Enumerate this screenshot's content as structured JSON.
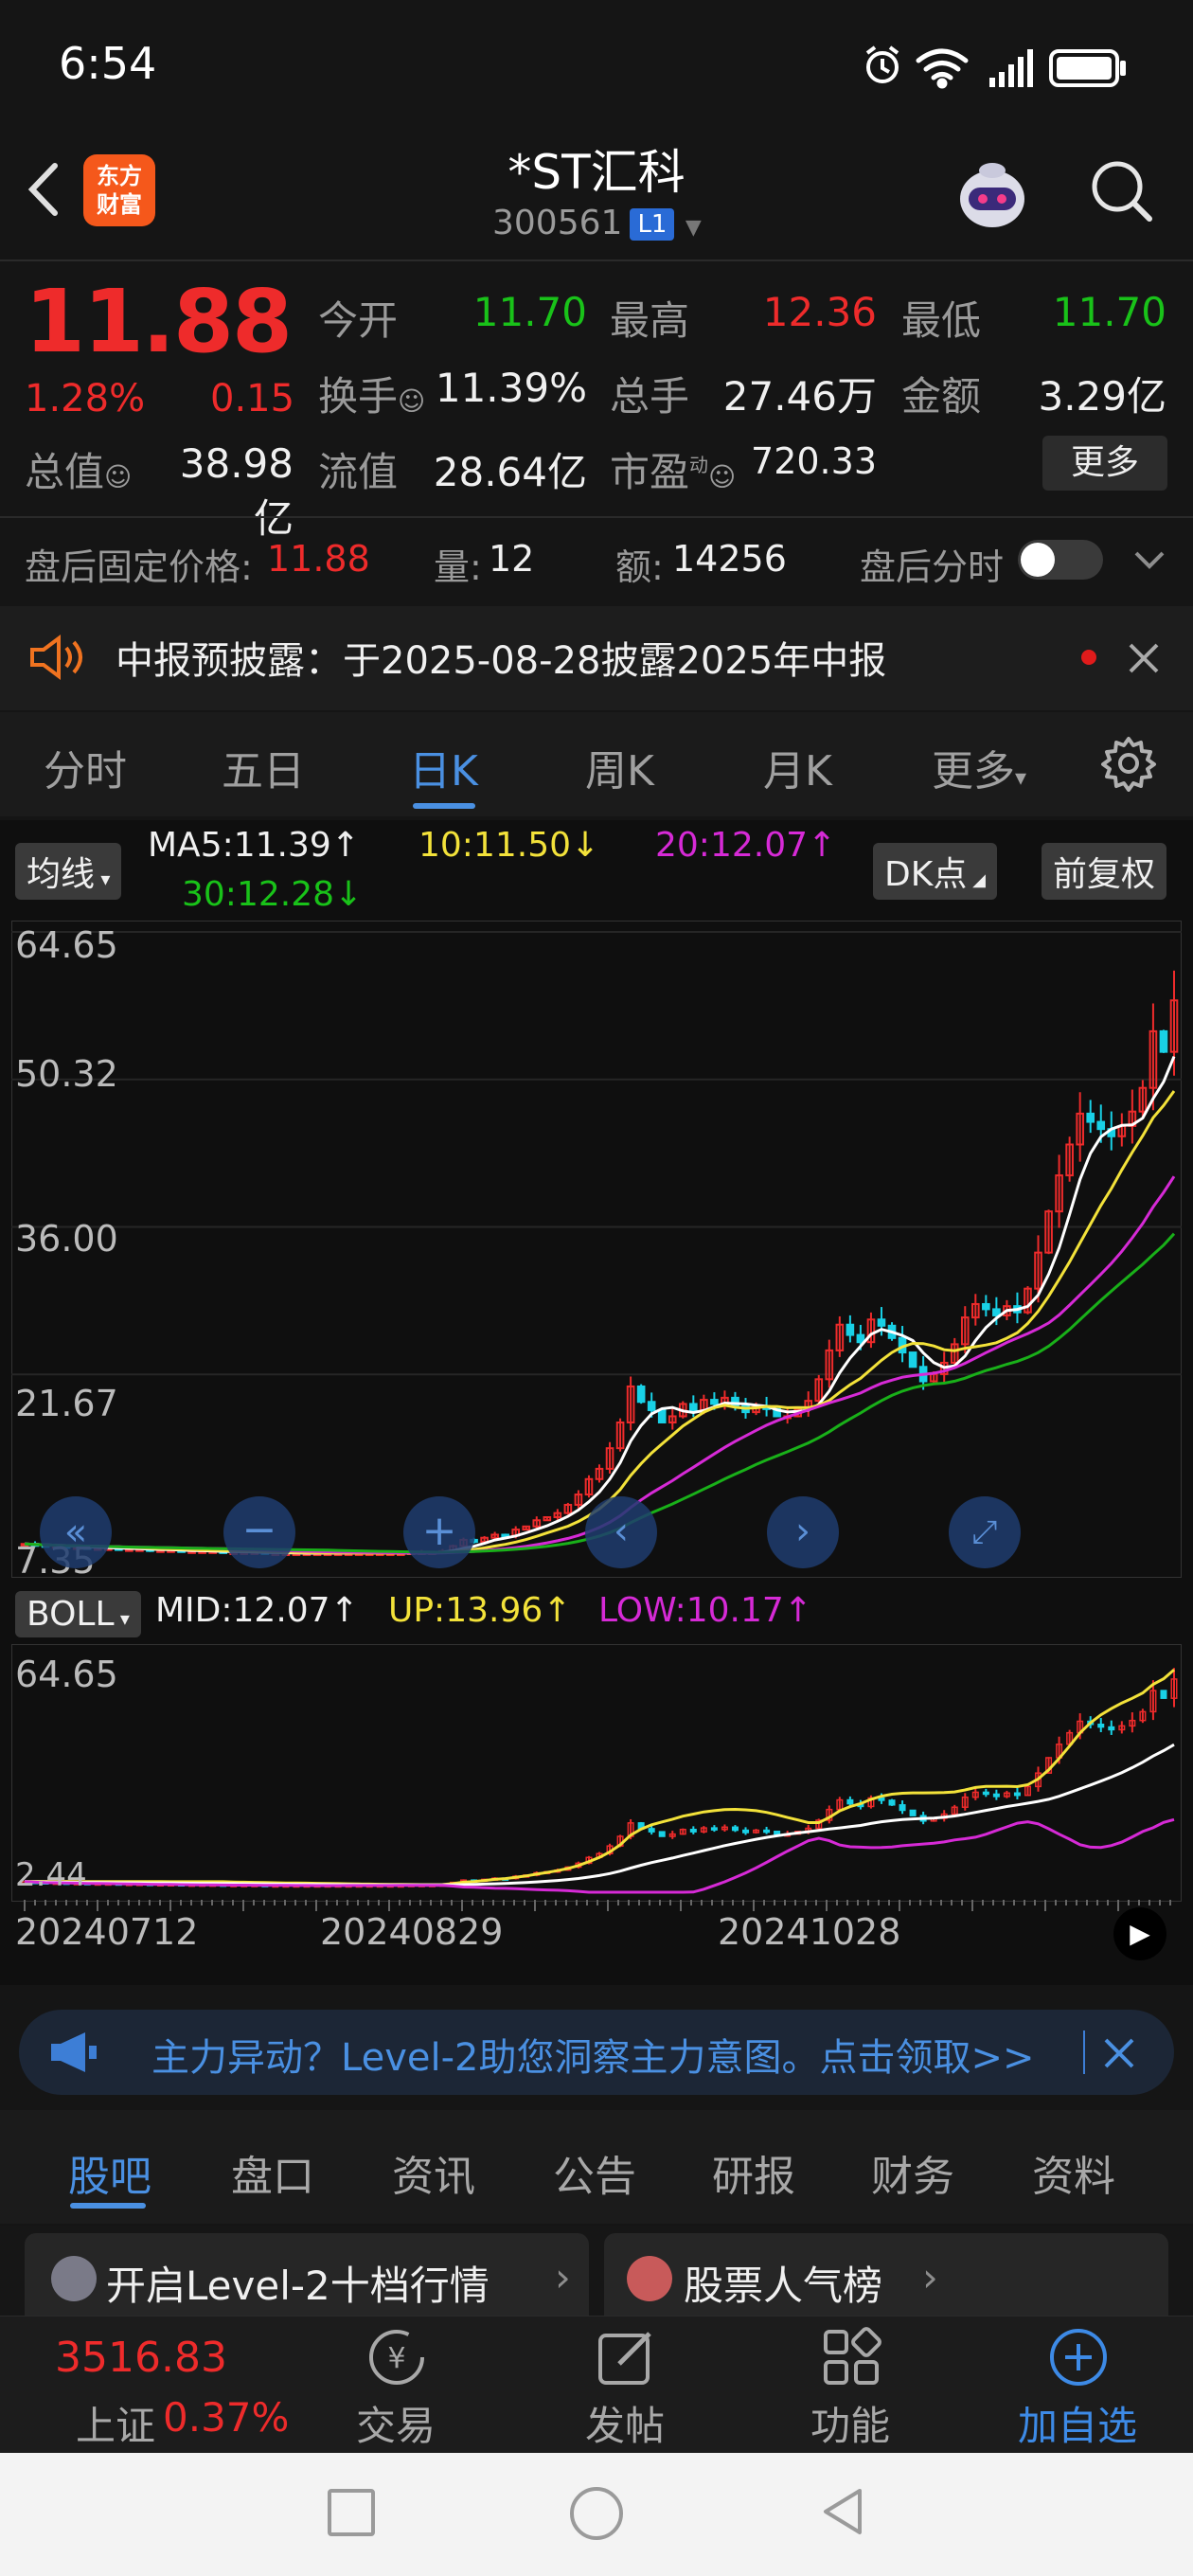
{
  "status": {
    "time": "6:54"
  },
  "header": {
    "logo_line1": "东方",
    "logo_line2": "财富",
    "name": "*ST汇科",
    "code": "300561",
    "level_badge": "L1"
  },
  "quote": {
    "price": "11.88",
    "change_pct": "1.28%",
    "change": "0.15",
    "fields": [
      {
        "label": "今开",
        "value": "11.70",
        "color": "green"
      },
      {
        "label": "最高",
        "value": "12.36",
        "color": "red"
      },
      {
        "label": "最低",
        "value": "11.70",
        "color": "green"
      },
      {
        "label": "换手",
        "value": "11.39%",
        "color": "white"
      },
      {
        "label": "总手",
        "value": "27.46万",
        "color": "white"
      },
      {
        "label": "金额",
        "value": "3.29亿",
        "color": "white"
      },
      {
        "label": "总值",
        "value": "38.98亿",
        "color": "white"
      },
      {
        "label": "流值",
        "value": "28.64亿",
        "color": "white"
      },
      {
        "label": "市盈",
        "value": "720.33",
        "color": "white"
      }
    ],
    "pe_superscript": "动",
    "more_label": "更多"
  },
  "after_hours": {
    "price_label": "盘后固定价格:",
    "price": "11.88",
    "vol_label": "量:",
    "vol": "12",
    "amount_label": "额:",
    "amount": "14256",
    "timeshare_label": "盘后分时"
  },
  "notice": {
    "text": "中报预披露：于2025-08-28披露2025年中报"
  },
  "chart_tabs": [
    {
      "label": "分时"
    },
    {
      "label": "五日"
    },
    {
      "label": "日K",
      "active": true
    },
    {
      "label": "周K"
    },
    {
      "label": "月K"
    },
    {
      "label": "更多"
    }
  ],
  "indicators": {
    "ma_selector": "均线",
    "ma5": "MA5:11.39",
    "ma10": "10:11.50",
    "ma20": "20:12.07",
    "ma30": "30:12.28",
    "dk_label": "DK点",
    "adjust_label": "前复权",
    "boll_selector": "BOLL",
    "boll_mid": "MID:12.07",
    "boll_up": "UP:13.96",
    "boll_low": "LOW:10.17"
  },
  "chart_data": {
    "type": "candlestick",
    "main_y_ticks": [
      "64.65",
      "50.32",
      "36.00",
      "21.67",
      "7.35"
    ],
    "sub_y_ticks": [
      "64.65",
      "2.44"
    ],
    "x_ticks": [
      "20240712",
      "20240829",
      "20241028"
    ],
    "ylim": [
      2.44,
      64.65
    ],
    "colors": {
      "up": "#ee2b2b",
      "down": "#19d1e6",
      "ma5": "#ffffff",
      "ma10": "#f3e23a",
      "ma20": "#d62ad6",
      "ma30": "#19b019"
    },
    "close": [
      5.2,
      5.1,
      5.0,
      5.0,
      4.9,
      4.9,
      4.8,
      4.8,
      4.8,
      4.7,
      4.7,
      4.7,
      4.6,
      4.6,
      4.6,
      4.5,
      4.5,
      4.5,
      4.5,
      4.4,
      4.4,
      4.4,
      4.4,
      4.3,
      4.3,
      4.3,
      4.3,
      4.3,
      4.3,
      4.3,
      4.3,
      4.3,
      4.3,
      4.3,
      4.3,
      4.3,
      4.3,
      4.4,
      4.4,
      4.4,
      4.5,
      5.0,
      5.6,
      5.4,
      5.8,
      6.1,
      6.0,
      6.6,
      6.9,
      7.5,
      7.8,
      8.2,
      9.0,
      10.0,
      11.5,
      12.5,
      14.5,
      17.0,
      20.5,
      19.0,
      18.2,
      17.0,
      17.6,
      18.8,
      18.2,
      19.2,
      18.8,
      19.4,
      18.6,
      18.0,
      18.6,
      18.3,
      17.6,
      17.6,
      18.3,
      19.1,
      21.2,
      24.0,
      26.5,
      25.5,
      24.8,
      27.0,
      26.4,
      25.2,
      23.8,
      22.4,
      21.0,
      21.7,
      22.8,
      24.6,
      27.2,
      28.5,
      28.0,
      27.4,
      28.3,
      27.7,
      30.0,
      33.5,
      37.5,
      41.0,
      44.0,
      47.0,
      46.2,
      45.5,
      44.8,
      45.8,
      47.2,
      49.5,
      55.0,
      53.0,
      58.0
    ]
  },
  "promo": {
    "text": "主力异动？Level-2助您洞察主力意图。点击领取>>"
  },
  "info_tabs": [
    {
      "label": "股吧",
      "active": true
    },
    {
      "label": "盘口"
    },
    {
      "label": "资讯"
    },
    {
      "label": "公告"
    },
    {
      "label": "研报"
    },
    {
      "label": "财务"
    },
    {
      "label": "资料"
    }
  ],
  "cards": [
    {
      "label": "开启Level-2十档行情"
    },
    {
      "label": "股票人气榜"
    }
  ],
  "bottom_nav": {
    "index_value": "3516.83",
    "index_name": "上证",
    "index_pct": "0.37%",
    "trade": "交易",
    "post": "发帖",
    "features": "功能",
    "add_watch": "加自选"
  }
}
